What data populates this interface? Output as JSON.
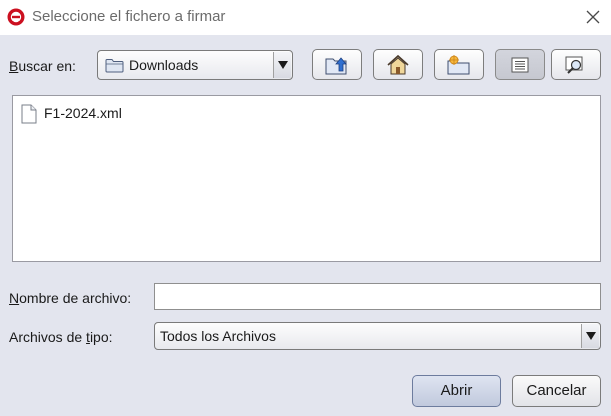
{
  "window": {
    "title": "Seleccione el fichero a firmar",
    "app_icon": "app-e-icon",
    "close_icon": "close-icon"
  },
  "lookin": {
    "label_mnemonic": "B",
    "label_rest": "uscar en:",
    "selected": "Downloads",
    "folder_icon": "folder-icon"
  },
  "toolbar": {
    "buttons": [
      "up-folder-icon",
      "home-icon",
      "new-folder-icon",
      "list-view-icon",
      "details-view-icon"
    ],
    "pressed": "list-view"
  },
  "files": [
    {
      "name": "F1-2024.xml",
      "icon": "document-icon"
    }
  ],
  "filename": {
    "label_mnemonic": "N",
    "label_rest": "ombre de archivo:",
    "value": ""
  },
  "filetype": {
    "label_before": "Archivos de ",
    "label_mnemonic": "t",
    "label_after": "ipo:",
    "selected": "Todos los Archivos"
  },
  "actions": {
    "open": "Abrir",
    "cancel": "Cancelar"
  },
  "colors": {
    "dialog_bg": "#e3e5ee",
    "accent": "#cc1020"
  }
}
